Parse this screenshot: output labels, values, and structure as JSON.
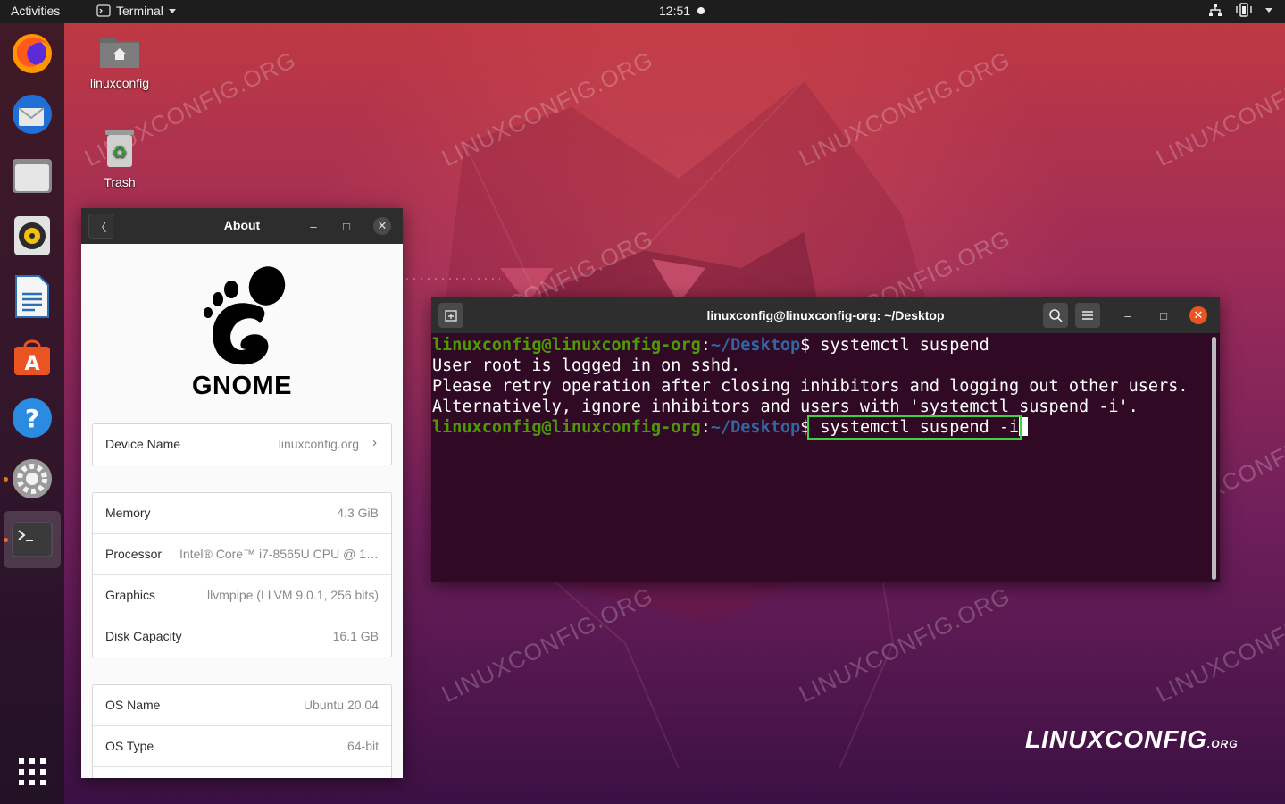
{
  "topbar": {
    "activities": "Activities",
    "app_name": "Terminal",
    "clock": "12:51"
  },
  "dock": {
    "items": [
      {
        "name": "Firefox",
        "icon": "firefox-icon"
      },
      {
        "name": "Thunderbird",
        "icon": "thunderbird-icon"
      },
      {
        "name": "Files",
        "icon": "files-icon"
      },
      {
        "name": "Rhythmbox",
        "icon": "rhythmbox-icon"
      },
      {
        "name": "LibreOffice Writer",
        "icon": "writer-icon"
      },
      {
        "name": "Ubuntu Software",
        "icon": "software-icon"
      },
      {
        "name": "Help",
        "icon": "help-icon"
      },
      {
        "name": "Settings",
        "icon": "settings-icon"
      },
      {
        "name": "Terminal",
        "icon": "terminal-icon"
      }
    ],
    "show_apps_icon": "app-grid-icon"
  },
  "desktop": {
    "home_label": "linuxconfig",
    "trash_label": "Trash"
  },
  "about": {
    "title": "About",
    "logo_text": "GNOME",
    "device_group": [
      {
        "key": "Device Name",
        "value": "linuxconfig.org"
      }
    ],
    "hardware_group": [
      {
        "key": "Memory",
        "value": "4.3 GiB"
      },
      {
        "key": "Processor",
        "value": "Intel® Core™ i7-8565U CPU @ 1…"
      },
      {
        "key": "Graphics",
        "value": "llvmpipe (LLVM 9.0.1, 256 bits)"
      },
      {
        "key": "Disk Capacity",
        "value": "16.1 GB"
      }
    ],
    "os_group": [
      {
        "key": "OS Name",
        "value": "Ubuntu 20.04"
      },
      {
        "key": "OS Type",
        "value": "64-bit"
      }
    ]
  },
  "terminal": {
    "title": "linuxconfig@linuxconfig-org: ~/Desktop",
    "prompt_user": "linuxconfig@linuxconfig-org",
    "prompt_sep": ":",
    "prompt_dir": "~/Desktop",
    "prompt_symbol": "$",
    "cmd1": " systemctl suspend",
    "out1": "User root is logged in on sshd.",
    "out2": "Please retry operation after closing inhibitors and logging out other users.",
    "out3": "Alternatively, ignore inhibitors and users with 'systemctl suspend -i'.",
    "cmd2": " systemctl suspend -i"
  },
  "watermark": "LINUXCONFIG.ORG",
  "brand": {
    "main": "LINUXCONFIG",
    "suffix": ".ORG"
  },
  "colors": {
    "prompt_green": "#4e9a06",
    "prompt_blue": "#3465a4",
    "terminal_bg": "#300a24",
    "highlight": "#40d040",
    "accent_orange": "#f46a25"
  }
}
